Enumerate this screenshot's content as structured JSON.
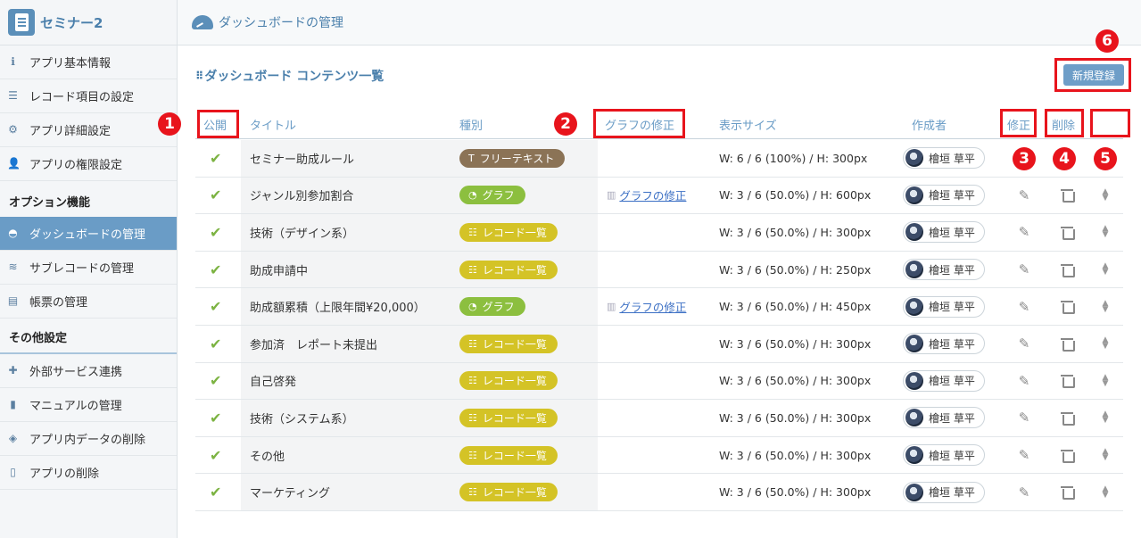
{
  "app": {
    "name": "セミナー2"
  },
  "sidebar": {
    "items": [
      {
        "label": "アプリ基本情報",
        "icon": "info-icon"
      },
      {
        "label": "レコード項目の設定",
        "icon": "list-lines-icon"
      },
      {
        "label": "アプリ詳細設定",
        "icon": "gear-icon"
      },
      {
        "label": "アプリの権限設定",
        "icon": "user-lock-icon"
      }
    ],
    "option_section": "オプション機能",
    "option_items": [
      {
        "label": "ダッシュボードの管理",
        "icon": "dashboard-gauge-icon",
        "active": true
      },
      {
        "label": "サブレコードの管理",
        "icon": "sublayers-icon"
      },
      {
        "label": "帳票の管理",
        "icon": "excel-form-icon"
      }
    ],
    "other_section": "その他設定",
    "other_items": [
      {
        "label": "外部サービス連携",
        "icon": "puzzle-icon"
      },
      {
        "label": "マニュアルの管理",
        "icon": "book-icon"
      },
      {
        "label": "アプリ内データの削除",
        "icon": "eraser-icon"
      },
      {
        "label": "アプリの削除",
        "icon": "trash-icon"
      }
    ]
  },
  "topbar": {
    "title": "ダッシュボードの管理"
  },
  "content": {
    "heading": "ダッシュボード コンテンツ一覧",
    "new_button": "新規登録"
  },
  "table": {
    "headers": {
      "public": "公開",
      "title": "タイトル",
      "kind": "種別",
      "graph_edit": "グラフの修正",
      "size": "表示サイズ",
      "author": "作成者",
      "edit": "修正",
      "delete": "削除"
    },
    "rows": [
      {
        "title": "セミナー助成ルール",
        "kind": "フリーテキスト",
        "kind_type": "free",
        "graph_link": "",
        "size": "W: 6 / 6 (100%) / H: 300px",
        "author": "檜垣 草平",
        "actions": false
      },
      {
        "title": "ジャンル別参加割合",
        "kind": "グラフ",
        "kind_type": "graph",
        "graph_link": "グラフの修正",
        "size": "W: 3 / 6 (50.0%) / H: 600px",
        "author": "檜垣 草平",
        "actions": true
      },
      {
        "title": "技術（デザイン系）",
        "kind": "レコード一覧",
        "kind_type": "list",
        "graph_link": "",
        "size": "W: 3 / 6 (50.0%) / H: 300px",
        "author": "檜垣 草平",
        "actions": true
      },
      {
        "title": "助成申請中",
        "kind": "レコード一覧",
        "kind_type": "list",
        "graph_link": "",
        "size": "W: 3 / 6 (50.0%) / H: 250px",
        "author": "檜垣 草平",
        "actions": true
      },
      {
        "title": "助成額累積（上限年間¥20,000）",
        "kind": "グラフ",
        "kind_type": "graph",
        "graph_link": "グラフの修正",
        "size": "W: 3 / 6 (50.0%) / H: 450px",
        "author": "檜垣 草平",
        "actions": true
      },
      {
        "title": "参加済　レポート未提出",
        "kind": "レコード一覧",
        "kind_type": "list",
        "graph_link": "",
        "size": "W: 3 / 6 (50.0%) / H: 300px",
        "author": "檜垣 草平",
        "actions": true
      },
      {
        "title": "自己啓発",
        "kind": "レコード一覧",
        "kind_type": "list",
        "graph_link": "",
        "size": "W: 3 / 6 (50.0%) / H: 300px",
        "author": "檜垣 草平",
        "actions": true
      },
      {
        "title": "技術（システム系）",
        "kind": "レコード一覧",
        "kind_type": "list",
        "graph_link": "",
        "size": "W: 3 / 6 (50.0%) / H: 300px",
        "author": "檜垣 草平",
        "actions": true
      },
      {
        "title": "その他",
        "kind": "レコード一覧",
        "kind_type": "list",
        "graph_link": "",
        "size": "W: 3 / 6 (50.0%) / H: 300px",
        "author": "檜垣 草平",
        "actions": true
      },
      {
        "title": "マーケティング",
        "kind": "レコード一覧",
        "kind_type": "list",
        "graph_link": "",
        "size": "W: 3 / 6 (50.0%) / H: 300px",
        "author": "檜垣 草平",
        "actions": true
      }
    ]
  },
  "annotations": {
    "markers": [
      "1",
      "2",
      "3",
      "4",
      "5",
      "6"
    ],
    "color": "#e8141c"
  }
}
